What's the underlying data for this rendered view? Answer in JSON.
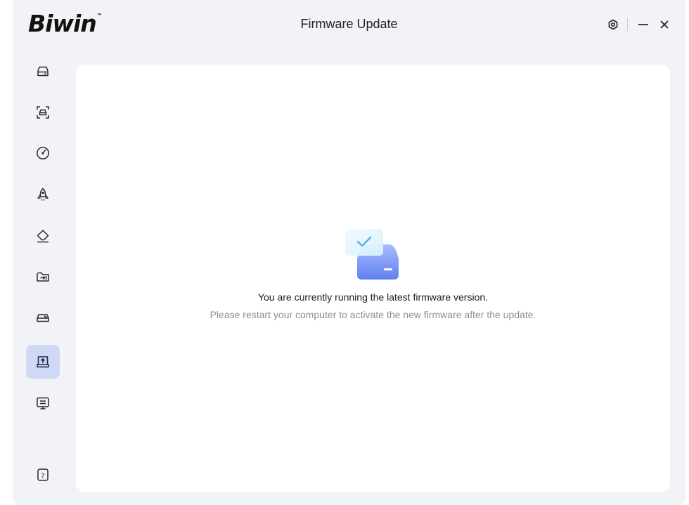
{
  "app": {
    "logo_text": "Biwin",
    "logo_tm": "™",
    "title": "Firmware Update"
  },
  "window_controls": {
    "settings_icon": "settings-icon",
    "minimize_icon": "minimize-icon",
    "close_icon": "close-icon"
  },
  "sidebar": {
    "items": [
      {
        "name": "drive",
        "icon": "drive-icon",
        "active": false
      },
      {
        "name": "scan",
        "icon": "scan-drive-icon",
        "active": false
      },
      {
        "name": "benchmark",
        "icon": "gauge-icon",
        "active": false
      },
      {
        "name": "boost",
        "icon": "rocket-icon",
        "active": false
      },
      {
        "name": "erase",
        "icon": "eraser-icon",
        "active": false
      },
      {
        "name": "migrate",
        "icon": "folder-transfer-icon",
        "active": false
      },
      {
        "name": "clone",
        "icon": "clone-drive-icon",
        "active": false
      },
      {
        "name": "firmware-update",
        "icon": "firmware-upload-icon",
        "active": true
      },
      {
        "name": "system-info",
        "icon": "monitor-icon",
        "active": false
      }
    ],
    "help_icon": "help-icon",
    "help_glyph": "?"
  },
  "main": {
    "status_icon": "drive-check-icon",
    "message": "You are currently running the latest firmware version.",
    "note": "Please restart your computer to activate the new firmware after the update."
  },
  "colors": {
    "window_bg": "#f1f3f7",
    "panel_bg": "#ffffff",
    "active_item_bg": "#cfd8f4",
    "accent": "#5b7cf0",
    "text_primary": "#1c1c1c",
    "text_secondary": "#8a8e95"
  }
}
